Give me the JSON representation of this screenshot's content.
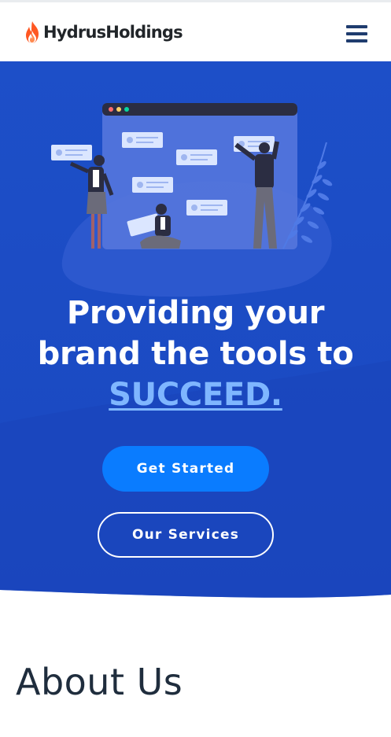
{
  "brand": {
    "name": "HydrusHoldings",
    "logo_icon": "flame-icon",
    "logo_color": "#ff5722"
  },
  "nav": {
    "menu_icon": "hamburger-menu-icon"
  },
  "hero": {
    "headline_line1": "Providing your",
    "headline_line2": "brand the tools to",
    "headline_accent": "SUCCEED.",
    "primary_button": "Get Started",
    "secondary_button": "Our Services",
    "colors": {
      "background": "#1e4fc8",
      "accent_text": "#7fb6ff",
      "primary_button": "#0a7cff"
    }
  },
  "about": {
    "title": "About Us"
  }
}
